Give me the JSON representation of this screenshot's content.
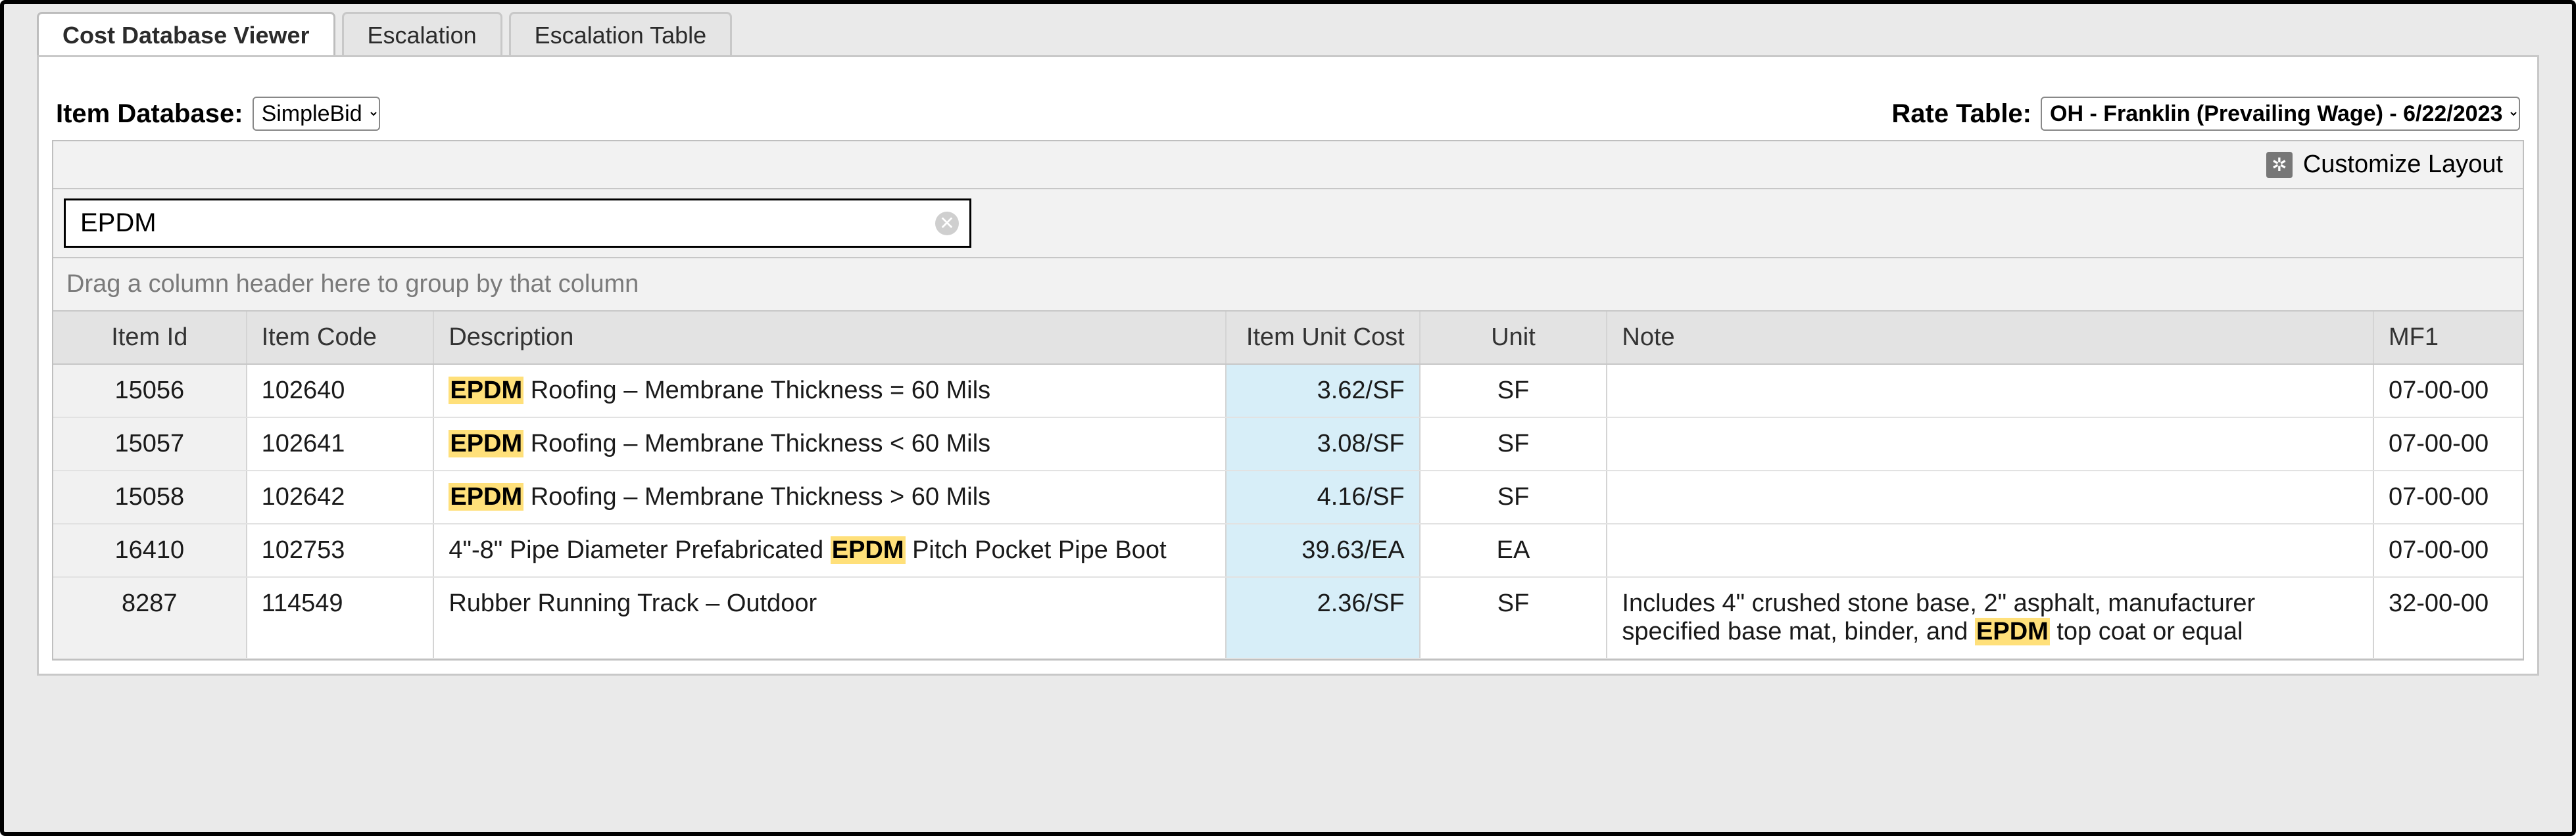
{
  "tabs": [
    {
      "label": "Cost Database Viewer",
      "active": true
    },
    {
      "label": "Escalation",
      "active": false
    },
    {
      "label": "Escalation Table",
      "active": false
    }
  ],
  "toolbar": {
    "item_db_label": "Item Database:",
    "item_db_value": "SimpleBid",
    "rate_table_label": "Rate Table:",
    "rate_table_value": "OH - Franklin (Prevailing Wage) - 6/22/2023"
  },
  "grid": {
    "customize_label": "Customize Layout",
    "search_value": "EPDM",
    "group_placeholder": "Drag a column header here to group by that column",
    "highlight_term": "EPDM",
    "columns": [
      {
        "key": "item_id",
        "label": "Item Id"
      },
      {
        "key": "item_code",
        "label": "Item Code"
      },
      {
        "key": "desc",
        "label": "Description"
      },
      {
        "key": "unit_cost",
        "label": "Item Unit Cost"
      },
      {
        "key": "unit",
        "label": "Unit"
      },
      {
        "key": "note",
        "label": "Note"
      },
      {
        "key": "mf1",
        "label": "MF1"
      }
    ],
    "rows": [
      {
        "item_id": "15056",
        "item_code": "102640",
        "desc": "EPDM Roofing – Membrane Thickness = 60 Mils",
        "unit_cost": "3.62/SF",
        "unit": "SF",
        "note": "",
        "mf1": "07-00-00"
      },
      {
        "item_id": "15057",
        "item_code": "102641",
        "desc": "EPDM Roofing – Membrane Thickness < 60 Mils",
        "unit_cost": "3.08/SF",
        "unit": "SF",
        "note": "",
        "mf1": "07-00-00"
      },
      {
        "item_id": "15058",
        "item_code": "102642",
        "desc": "EPDM Roofing – Membrane Thickness > 60 Mils",
        "unit_cost": "4.16/SF",
        "unit": "SF",
        "note": "",
        "mf1": "07-00-00"
      },
      {
        "item_id": "16410",
        "item_code": "102753",
        "desc": "4\"-8\" Pipe Diameter Prefabricated EPDM Pitch Pocket Pipe Boot",
        "unit_cost": "39.63/EA",
        "unit": "EA",
        "note": "",
        "mf1": "07-00-00"
      },
      {
        "item_id": "8287",
        "item_code": "114549",
        "desc": "Rubber Running Track – Outdoor",
        "unit_cost": "2.36/SF",
        "unit": "SF",
        "note": "Includes 4\" crushed stone base, 2\" asphalt, manufacturer specified base mat, binder, and EPDM top coat or equal",
        "mf1": "32-00-00"
      }
    ]
  }
}
